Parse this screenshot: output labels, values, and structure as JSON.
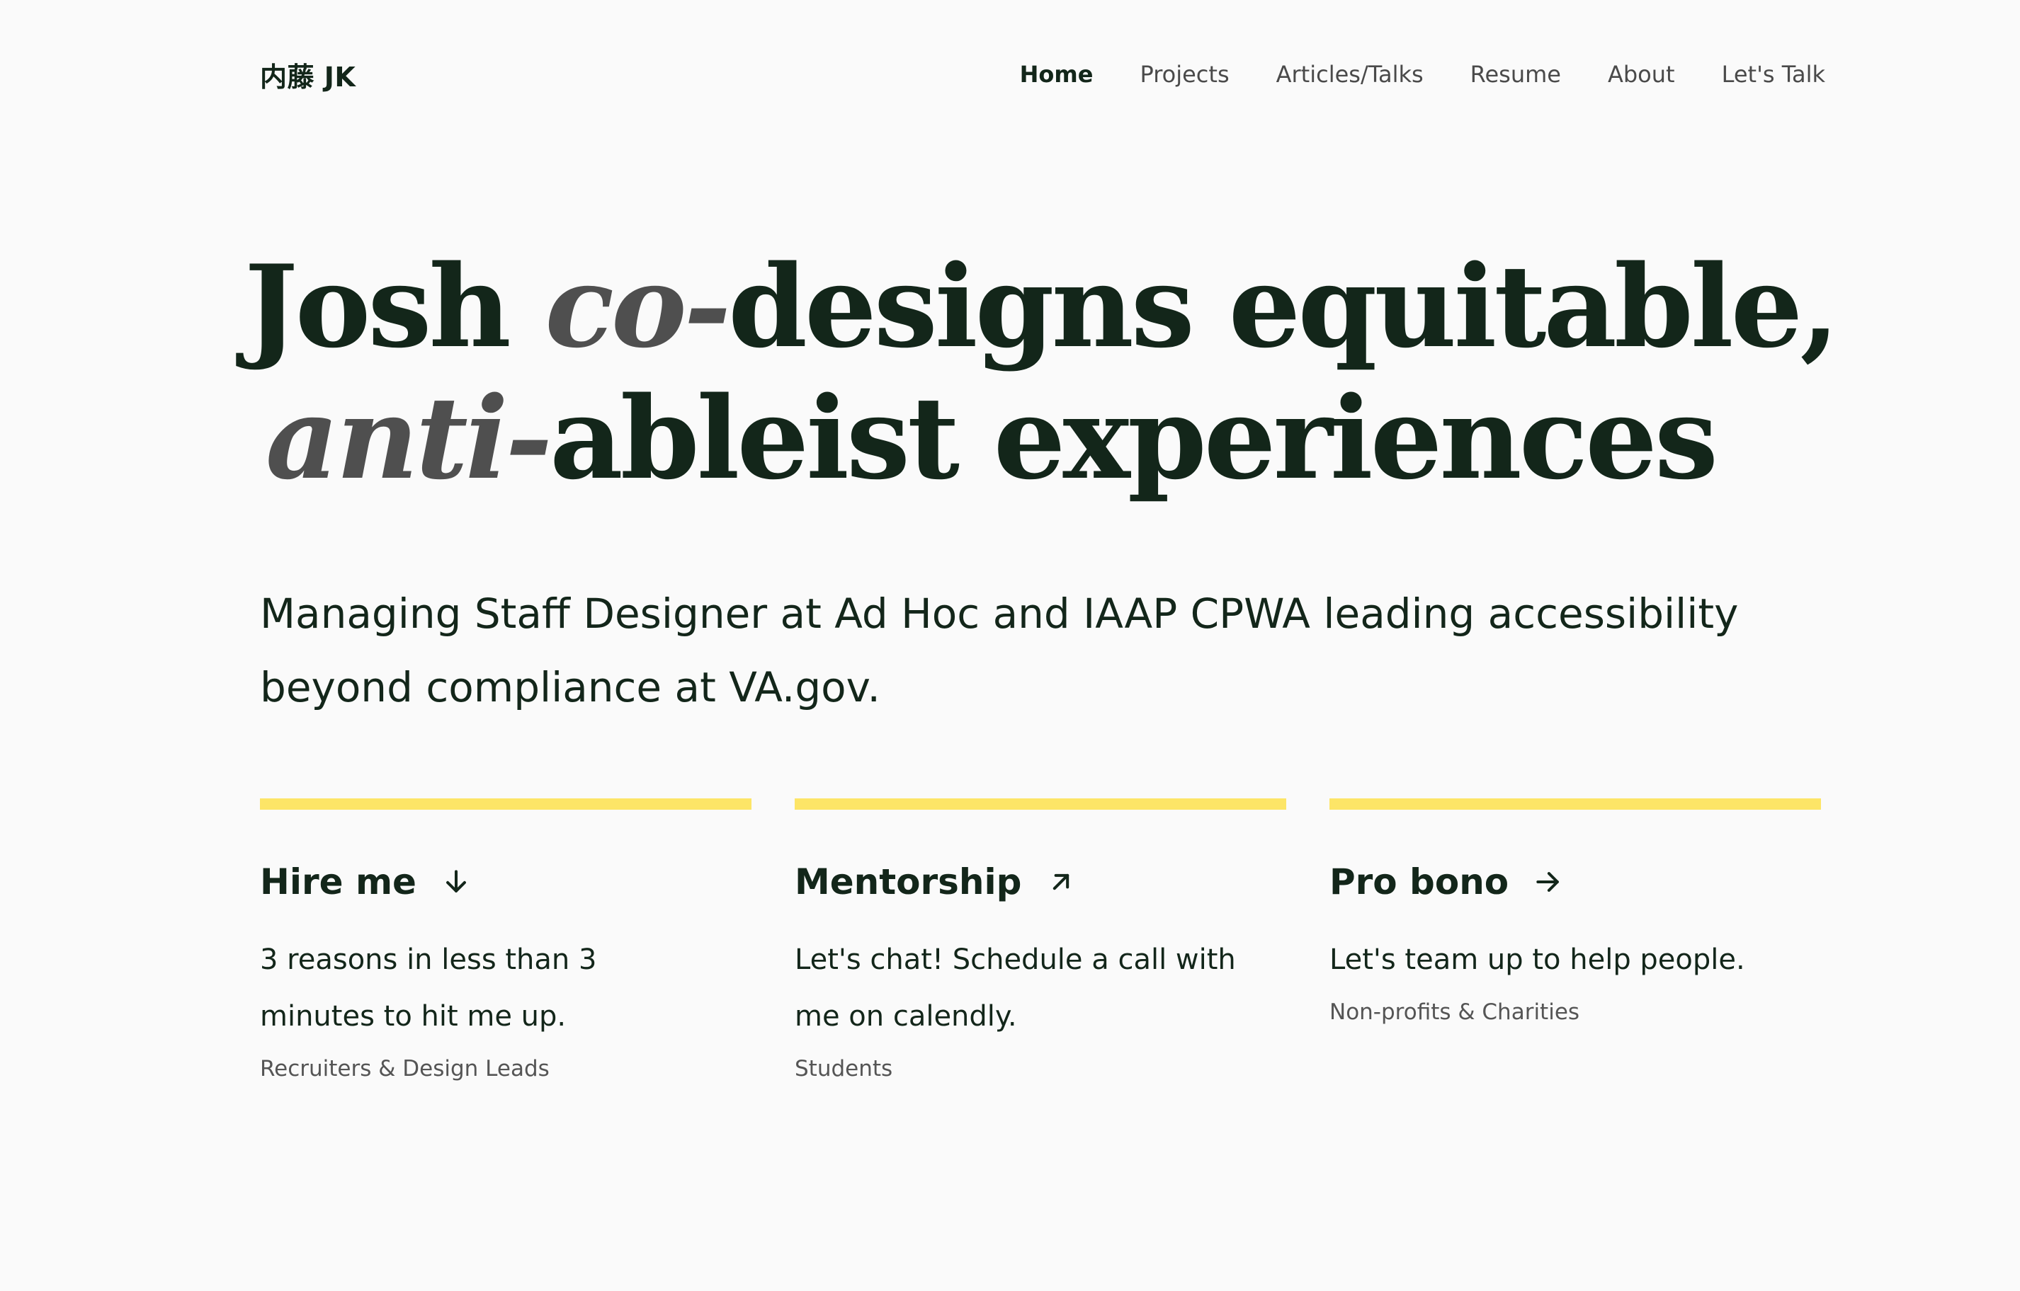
{
  "header": {
    "logo": "内藤 JK",
    "nav": [
      {
        "label": "Home",
        "active": true
      },
      {
        "label": "Projects",
        "active": false
      },
      {
        "label": "Articles/Talks",
        "active": false
      },
      {
        "label": "Resume",
        "active": false
      },
      {
        "label": "About",
        "active": false
      },
      {
        "label": "Let's Talk",
        "active": false
      }
    ]
  },
  "hero": {
    "title": {
      "part1": "Josh ",
      "em1": "co-",
      "part2": "designs equitable,",
      "em2": "anti-",
      "part3": "ableist experiences"
    },
    "subtitle": "Managing Staff Designer at Ad Hoc and IAAP CPWA leading accessibility beyond compliance at VA.gov."
  },
  "cards": [
    {
      "title": "Hire me",
      "icon": "arrow-down-icon",
      "description": "3 reasons in less than 3 minutes to hit me up.",
      "tag": "Recruiters & Design Leads"
    },
    {
      "title": "Mentorship",
      "icon": "arrow-up-right-icon",
      "description": "Let's chat! Schedule a call with me on calendly.",
      "tag": "Students"
    },
    {
      "title": "Pro bono",
      "icon": "arrow-right-icon",
      "description": "Let's team up to help people.",
      "tag": "Non-profits & Charities"
    }
  ],
  "colors": {
    "background": "#fafafa",
    "text": "#13261a",
    "accent_bar": "#fde567",
    "muted": "#4f4f4f"
  }
}
